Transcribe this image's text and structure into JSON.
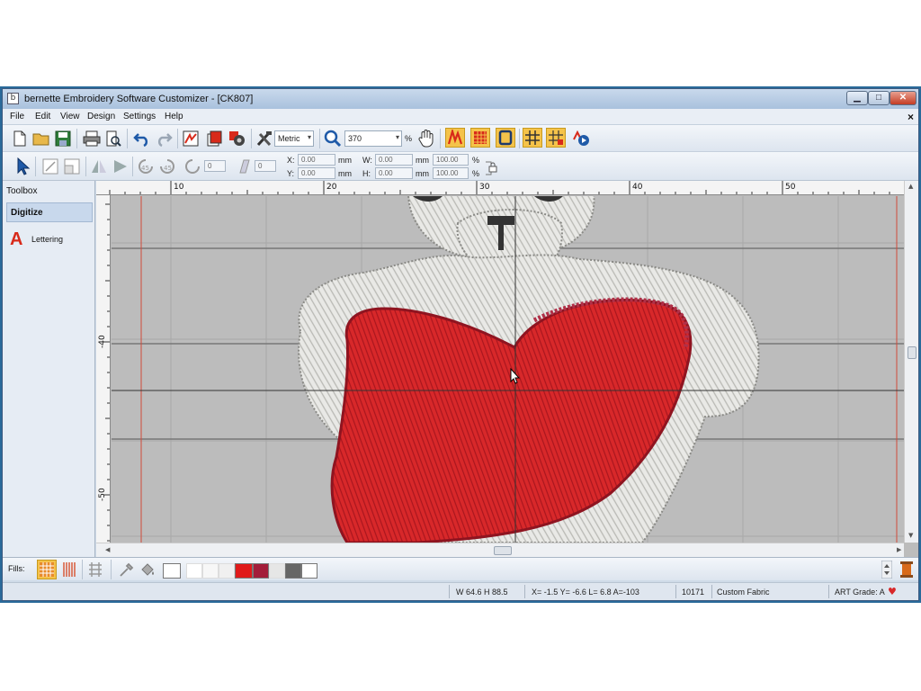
{
  "window": {
    "app_icon": "b",
    "title": "bernette Embroidery Software Customizer - [CK807]",
    "controls": {
      "minimize": "▁",
      "maximize": "□",
      "close": "✕"
    }
  },
  "menu": {
    "items": [
      "File",
      "Edit",
      "View",
      "Design",
      "Settings",
      "Help"
    ],
    "doc_close": "×"
  },
  "toolbar": {
    "units": "Metric",
    "zoom_value": "370",
    "zoom_unit": "%",
    "icons": [
      "new-file-icon",
      "open-folder-icon",
      "save-icon",
      "print-icon",
      "print-preview-icon",
      "undo-icon",
      "redo-icon",
      "color-film-icon",
      "auto-icon",
      "settings-gear-icon",
      "tools-icon",
      "zoom-icon",
      "pan-hand-icon",
      "stitch-view-icon",
      "fill-view-icon",
      "hoop-icon",
      "grid-icon",
      "grid-settings-icon",
      "stitch-player-icon"
    ]
  },
  "transform": {
    "rotate_value": "0",
    "slant_value": "0",
    "x_label": "X:",
    "x_value": "0.00",
    "y_label": "Y:",
    "y_value": "0.00",
    "w_label": "W:",
    "w_value": "0.00",
    "h_label": "H:",
    "h_value": "0.00",
    "unit_mm": "mm",
    "scale_w": "100.00",
    "scale_h": "100.00",
    "pct": "%"
  },
  "left_panel": {
    "toolbox_label": "Toolbox",
    "digitize_label": "Digitize",
    "lettering_icon": "A",
    "lettering_label": "Lettering"
  },
  "rulers": {
    "h_ticks": [
      "10",
      "20",
      "30",
      "40",
      "50"
    ],
    "v_ticks": [
      "-40",
      "-50"
    ]
  },
  "fills": {
    "label": "Fills:",
    "palette": [
      "#ffffff",
      "#f7f7f7",
      "#f0f0f0",
      "#e01a1a",
      "#a31d3a",
      "#e6e6e6",
      "#666666",
      "#ffffff"
    ]
  },
  "status": {
    "size": "W  64.6 H  88.5",
    "coords": "X=  -1.5 Y=  -6.6 L=  6.8 A=-103",
    "stitches": "10171",
    "fabric": "Custom Fabric",
    "art_grade": "ART Grade: A",
    "art_grade_icon": "♥"
  },
  "colors": {
    "heart_red": "#d8282a",
    "bear_white": "#ececec",
    "canvas_gray": "#bcbcbc"
  }
}
